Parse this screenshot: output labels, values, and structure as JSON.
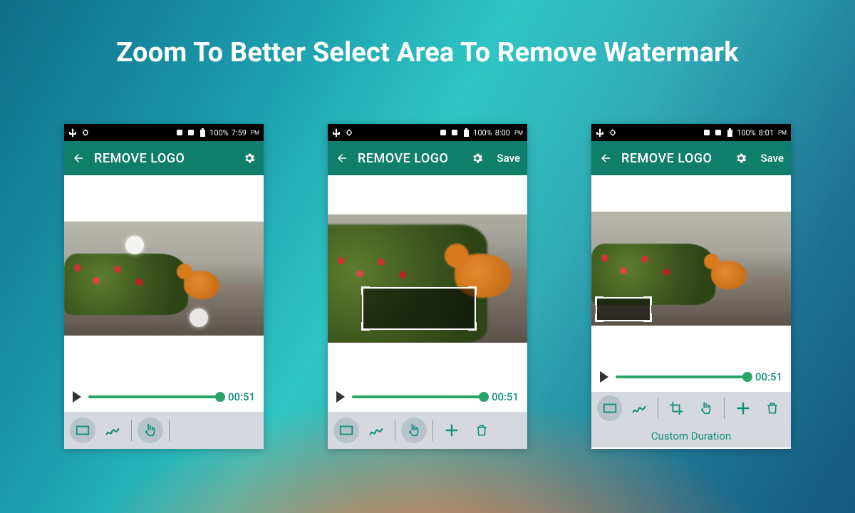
{
  "headline": "Zoom To Better Select Area To Remove Watermark",
  "phones": [
    {
      "status": {
        "battery": "100%",
        "time": "7:59",
        "ampm": "PM"
      },
      "appbar": {
        "title": "REMOVE LOGO",
        "save": ""
      },
      "player": {
        "time": "00:51"
      },
      "extra": ""
    },
    {
      "status": {
        "battery": "100%",
        "time": "8:00",
        "ampm": "PM"
      },
      "appbar": {
        "title": "REMOVE LOGO",
        "save": "Save"
      },
      "player": {
        "time": "00:51"
      },
      "extra": ""
    },
    {
      "status": {
        "battery": "100%",
        "time": "8:01",
        "ampm": "PM"
      },
      "appbar": {
        "title": "REMOVE LOGO",
        "save": "Save"
      },
      "player": {
        "time": "00:51"
      },
      "extra": "Custom Duration"
    }
  ]
}
